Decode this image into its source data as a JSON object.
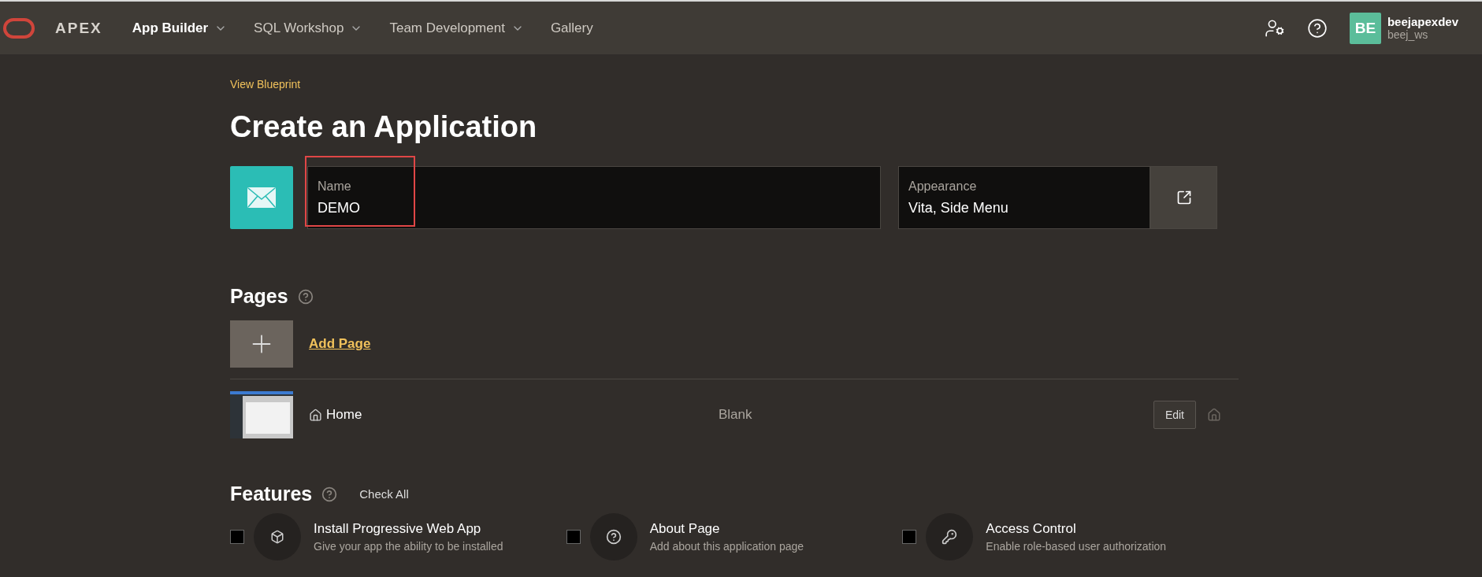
{
  "header": {
    "brand": "APEX",
    "nav": [
      {
        "label": "App Builder",
        "selected": true,
        "dropdown": true
      },
      {
        "label": "SQL Workshop",
        "selected": false,
        "dropdown": true
      },
      {
        "label": "Team Development",
        "selected": false,
        "dropdown": true
      },
      {
        "label": "Gallery",
        "selected": false,
        "dropdown": false
      }
    ],
    "user": {
      "initials": "BE",
      "name": "beejapexdev",
      "workspace": "beej_ws"
    }
  },
  "blueprint_link": "View Blueprint",
  "title": "Create an Application",
  "name_field": {
    "label": "Name",
    "value": "DEMO",
    "highlighted": true
  },
  "appearance_field": {
    "label": "Appearance",
    "value": "Vita, Side Menu"
  },
  "pages": {
    "title": "Pages",
    "add_label": "Add Page",
    "rows": [
      {
        "name": "Home",
        "type": "Blank",
        "edit": "Edit",
        "home": true
      }
    ]
  },
  "features": {
    "title": "Features",
    "check_all": "Check All",
    "items": [
      {
        "kind": "pwa",
        "title": "Install Progressive Web App",
        "description": "Give your app the ability to be installed",
        "checked": false
      },
      {
        "kind": "about",
        "title": "About Page",
        "description": "Add about this application page",
        "checked": false
      },
      {
        "kind": "access",
        "title": "Access Control",
        "description": "Enable role-based user authorization",
        "checked": false
      }
    ]
  }
}
